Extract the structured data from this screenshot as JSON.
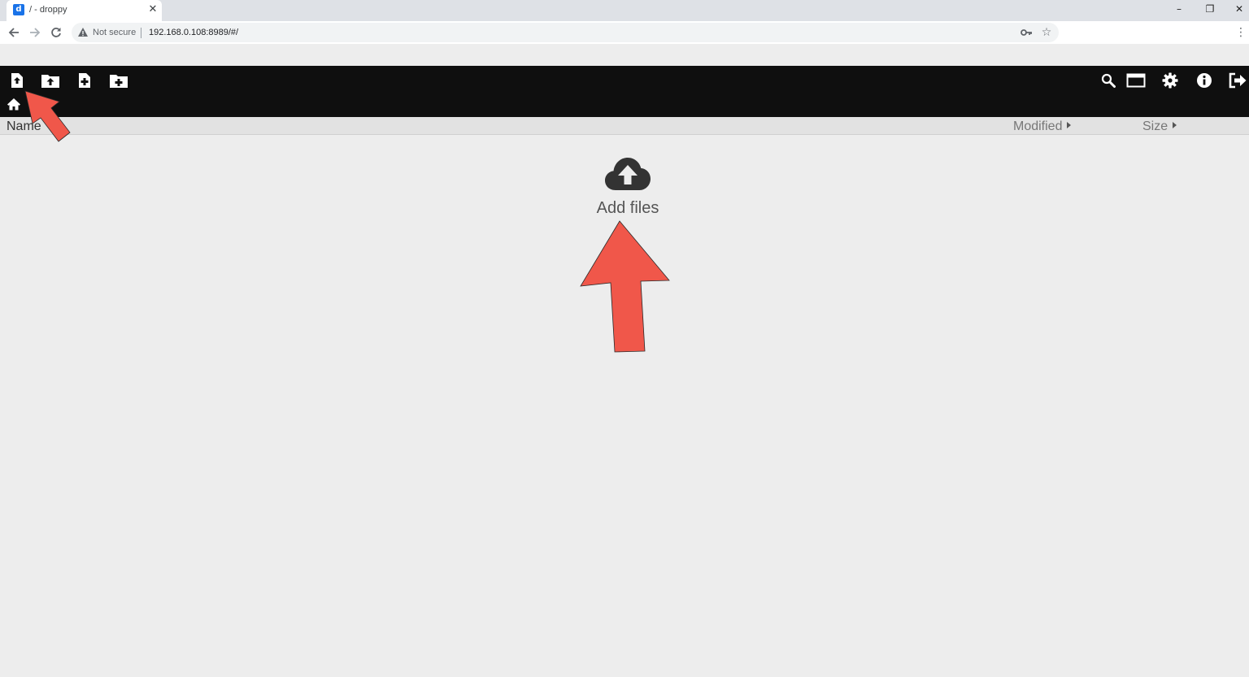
{
  "browser": {
    "tab_title": "/ - droppy",
    "tab_close": "✕",
    "favicon_glyph": "d",
    "not_secure_label": "Not secure",
    "url": "192.168.0.108:8989/#/",
    "window_controls": [
      "–",
      "❐",
      "✕"
    ]
  },
  "app": {
    "header_icons_left": [
      "upload-file-icon",
      "upload-folder-icon",
      "new-file-icon",
      "new-folder-icon"
    ],
    "header_icons_right": [
      "search-icon",
      "window-icon",
      "gear-icon",
      "info-icon",
      "logout-icon"
    ],
    "columns": {
      "name": "Name",
      "modified": "Modified",
      "size": "Size"
    },
    "empty_state": {
      "label": "Add files"
    }
  },
  "colors": {
    "header_bg": "#0f0f0f",
    "page_bg": "#ededed",
    "annotation_arrow": "#f0574a"
  }
}
